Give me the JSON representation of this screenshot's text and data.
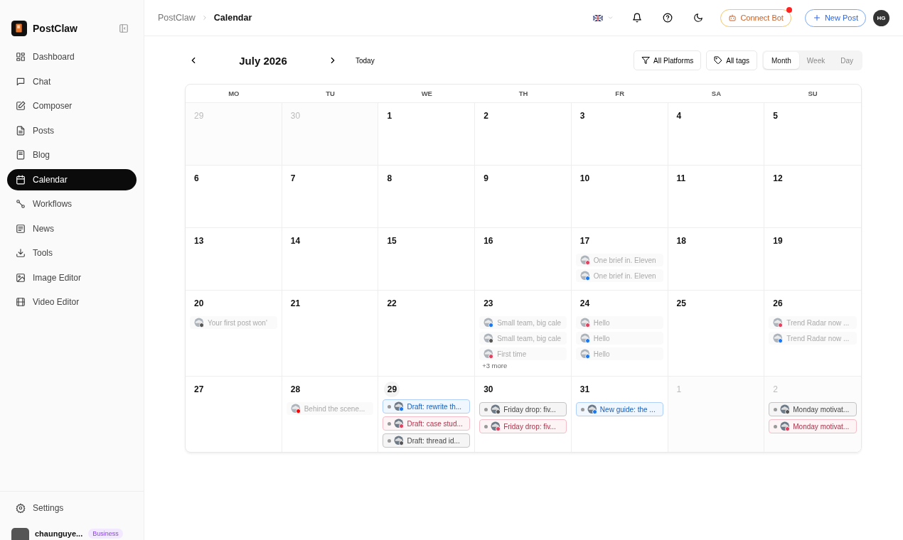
{
  "brand": {
    "name": "PostClaw"
  },
  "sidebar": {
    "items": [
      {
        "label": "Dashboard",
        "selected": false
      },
      {
        "label": "Chat",
        "selected": false
      },
      {
        "label": "Composer",
        "selected": false
      },
      {
        "label": "Posts",
        "selected": false
      },
      {
        "label": "Blog",
        "selected": false
      },
      {
        "label": "Calendar",
        "selected": true
      },
      {
        "label": "Workflows",
        "selected": false
      },
      {
        "label": "News",
        "selected": false
      },
      {
        "label": "Tools",
        "selected": false
      },
      {
        "label": "Image Editor",
        "selected": false
      },
      {
        "label": "Video Editor",
        "selected": false
      }
    ],
    "footer": {
      "settings": "Settings",
      "user": "chaunguye...",
      "plan": "Business"
    }
  },
  "breadcrumb": [
    "PostClaw",
    "Calendar"
  ],
  "header": {
    "connect": "Connect Bot",
    "connect_alert": true,
    "new_post": "New Post",
    "avatar": "HG"
  },
  "toolbar": {
    "month": "July 2026",
    "today": "Today",
    "platforms": "All Platforms",
    "tags": "All tags",
    "views": [
      {
        "label": "Month",
        "selected": true
      },
      {
        "label": "Week",
        "selected": false
      },
      {
        "label": "Day",
        "selected": false
      }
    ]
  },
  "calendar": {
    "weekdays": [
      "MO",
      "TU",
      "WE",
      "TH",
      "FR",
      "SA",
      "SU"
    ],
    "weeks": [
      {
        "days": [
          {
            "day": "29",
            "outside": true
          },
          {
            "day": "30",
            "outside": true
          },
          {
            "day": "1"
          },
          {
            "day": "2"
          },
          {
            "day": "3"
          },
          {
            "day": "4"
          },
          {
            "day": "5"
          }
        ]
      },
      {
        "days": [
          {
            "day": "6"
          },
          {
            "day": "7"
          },
          {
            "day": "8"
          },
          {
            "day": "9"
          },
          {
            "day": "10"
          },
          {
            "day": "11"
          },
          {
            "day": "12"
          }
        ]
      },
      {
        "days": [
          {
            "day": "13"
          },
          {
            "day": "14"
          },
          {
            "day": "15"
          },
          {
            "day": "16"
          },
          {
            "day": "17",
            "posts": [
              {
                "title": "One brief in. Eleven",
                "kind": "past",
                "color": "#e4405f"
              },
              {
                "title": "One brief in. Eleven",
                "kind": "past",
                "color": "#1877f2"
              }
            ]
          },
          {
            "day": "18"
          },
          {
            "day": "19"
          }
        ]
      },
      {
        "days": [
          {
            "day": "20",
            "posts": [
              {
                "title": "Your first post won'",
                "kind": "past",
                "color": "#555555"
              }
            ]
          },
          {
            "day": "21"
          },
          {
            "day": "22"
          },
          {
            "day": "23",
            "posts": [
              {
                "title": "Small team, big cale",
                "kind": "past",
                "color": "#1877f2"
              },
              {
                "title": "Small team, big cale",
                "kind": "past",
                "color": "#555555"
              },
              {
                "title": "First time",
                "kind": "past",
                "color": "#e4405f"
              }
            ],
            "more": "+3 more"
          },
          {
            "day": "24",
            "posts": [
              {
                "title": "Hello",
                "kind": "past",
                "color": "#e4405f"
              },
              {
                "title": "Hello",
                "kind": "past",
                "color": "#1877f2"
              },
              {
                "title": "Hello",
                "kind": "past",
                "color": "#1877f2"
              }
            ]
          },
          {
            "day": "25"
          },
          {
            "day": "26",
            "posts": [
              {
                "title": "Trend Radar now ...",
                "kind": "past",
                "color": "#e4405f"
              },
              {
                "title": "Trend Radar now ...",
                "kind": "past",
                "color": "#1877f2"
              }
            ]
          }
        ]
      },
      {
        "days": [
          {
            "day": "27"
          },
          {
            "day": "28",
            "posts": [
              {
                "title": "Behind the scene...",
                "kind": "past",
                "color": "#ff0000"
              }
            ]
          },
          {
            "day": "29",
            "today": true,
            "posts": [
              {
                "title": "Draft: rewrite th...",
                "kind": "scheduled",
                "color": "#1877f2"
              },
              {
                "title": "Draft: case stud...",
                "kind": "scheduled",
                "color": "#e4405f"
              },
              {
                "title": "Draft: thread id...",
                "kind": "scheduled",
                "color": "#555555"
              }
            ]
          },
          {
            "day": "30",
            "posts": [
              {
                "title": "Friday drop: fiv...",
                "kind": "scheduled",
                "color": "#555555"
              },
              {
                "title": "Friday drop: fiv...",
                "kind": "scheduled",
                "color": "#e4405f"
              }
            ]
          },
          {
            "day": "31",
            "posts": [
              {
                "title": "New guide: the ...",
                "kind": "scheduled",
                "color": "#1877f2"
              }
            ]
          },
          {
            "day": "1",
            "outside": true
          },
          {
            "day": "2",
            "outside": true,
            "posts": [
              {
                "title": "Monday motivat...",
                "kind": "scheduled",
                "color": "#555555"
              },
              {
                "title": "Monday motivat...",
                "kind": "scheduled",
                "color": "#e4405f"
              }
            ]
          }
        ]
      }
    ]
  }
}
